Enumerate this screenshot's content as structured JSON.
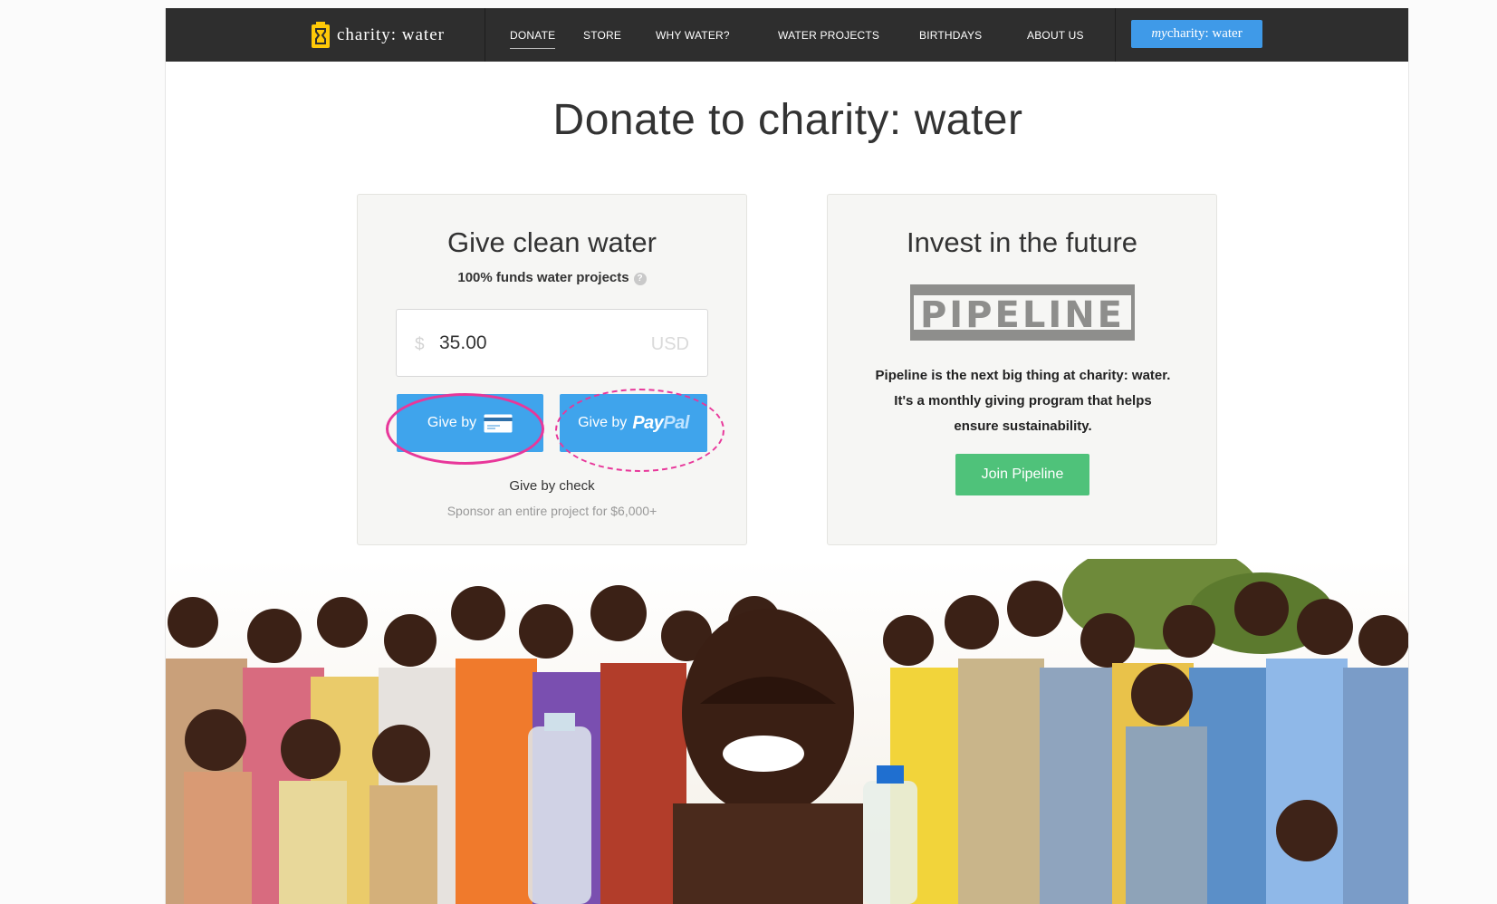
{
  "nav": {
    "brand": "charity: water",
    "items": [
      {
        "label": "DONATE",
        "active": true
      },
      {
        "label": "STORE"
      },
      {
        "label": "WHY WATER?"
      },
      {
        "label": "WATER PROJECTS"
      },
      {
        "label": "BIRTHDAYS"
      },
      {
        "label": "ABOUT US"
      }
    ],
    "my_prefix": "my",
    "my_suffix": "charity: water"
  },
  "page_title": "Donate to charity: water",
  "give": {
    "title": "Give clean water",
    "subtitle": "100% funds water projects",
    "help_icon": "question-icon",
    "currency_symbol": "$",
    "amount": "35.00",
    "currency_code": "USD",
    "card_button": "Give by",
    "card_icon": "credit-card-icon",
    "paypal_button": "Give by",
    "paypal_pay": "Pay",
    "paypal_pal": "Pal",
    "check_link": "Give by check",
    "sponsor_link": "Sponsor an entire project for $6,000+"
  },
  "pipeline": {
    "title": "Invest in the future",
    "logo": "PIPELINE",
    "description": "Pipeline is the next big thing at charity: water. It's a monthly giving program that helps ensure sustainability.",
    "button": "Join Pipeline"
  },
  "colors": {
    "nav_bg": "#2e2e2e",
    "accent_blue": "#3fa4ec",
    "my_button_blue": "#3f9ae8",
    "green": "#4fc27a",
    "annotation_pink": "#e8379a",
    "brand_yellow": "#ffc907"
  }
}
